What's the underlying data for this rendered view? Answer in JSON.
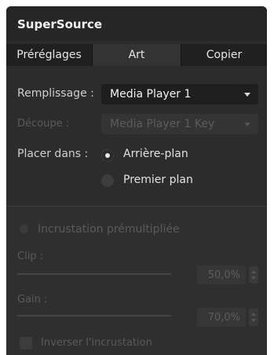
{
  "panel": {
    "title": "SuperSource"
  },
  "tabs": [
    {
      "label": "Préréglages",
      "active": false
    },
    {
      "label": "Art",
      "active": true
    },
    {
      "label": "Copier",
      "active": false
    }
  ],
  "fill": {
    "label": "Remplissage :",
    "value": "Media Player 1"
  },
  "key": {
    "label": "Découpe :",
    "value": "Media Player 1 Key",
    "enabled": false
  },
  "place": {
    "label": "Placer dans :",
    "options": [
      {
        "label": "Arrière-plan",
        "selected": true
      },
      {
        "label": "Premier plan",
        "selected": false
      }
    ]
  },
  "premultiplied": {
    "label": "Incrustation prémultipliée",
    "enabled": false
  },
  "clip": {
    "label": "Clip :",
    "value": "50,0%"
  },
  "gain": {
    "label": "Gain :",
    "value": "70,0%"
  },
  "invert": {
    "label": "Inverser l'incrustation",
    "enabled": false
  }
}
